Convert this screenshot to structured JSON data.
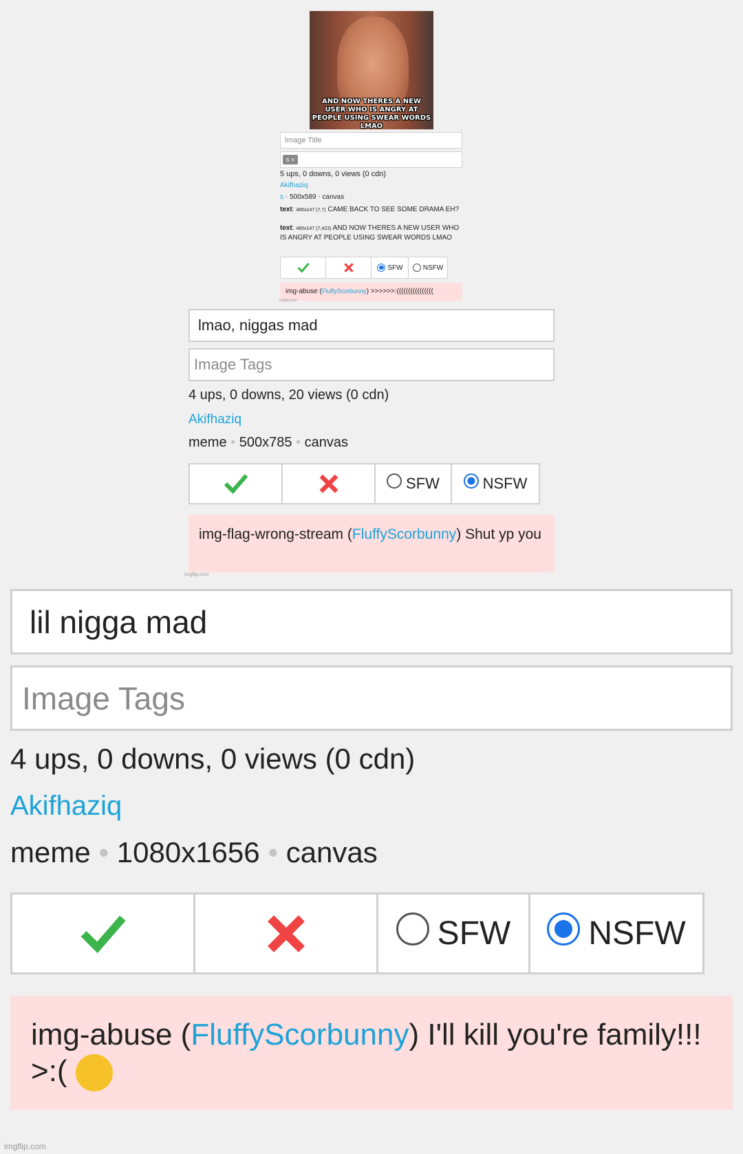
{
  "meme": {
    "caption": "AND NOW THERES A NEW USER WHO IS ANGRY AT PEOPLE USING SWEAR WORDS LMAO"
  },
  "level1": {
    "title_placeholder": "Image Title",
    "tag_chip": "s ×",
    "stats": "5 ups, 0 downs, 0 views (0 cdn)",
    "user": "Akifhaziq",
    "stream": "s",
    "size": "500x589",
    "type": "canvas",
    "text1_label": "text",
    "text1_meta": "485x147 (7,7)",
    "text1_value": "CAME BACK TO SEE SOME DRAMA EH?",
    "text2_label": "text",
    "text2_meta": "485x147 (7,423)",
    "text2_value": "AND NOW THERES A NEW USER WHO IS ANGRY AT PEOPLE USING SWEAR WORDS LMAO",
    "sfw": "SFW",
    "nsfw": "NSFW",
    "selected": "SFW",
    "flag_type": "img-abuse",
    "flag_user": "FluffyScorbunny",
    "flag_text": ">>>>>>:((((((((((((((((",
    "watermark": "imgflip.com"
  },
  "level2": {
    "title": "lmao, niggas mad",
    "tags_placeholder": "Image Tags",
    "stats": "4 ups, 0 downs, 20 views (0 cdn)",
    "user": "Akifhaziq",
    "stream": "meme",
    "size": "500x785",
    "type": "canvas",
    "sfw": "SFW",
    "nsfw": "NSFW",
    "selected": "NSFW",
    "flag_type": "img-flag-wrong-stream",
    "flag_user": "FluffyScorbunny",
    "flag_text": "Shut yp you",
    "watermark": "imgflip.com"
  },
  "level3": {
    "title": "lil nigga mad",
    "tags_placeholder": "Image Tags",
    "stats": "4 ups, 0 downs, 0 views (0 cdn)",
    "user": "Akifhaziq",
    "stream": "meme",
    "size": "1080x1656",
    "type": "canvas",
    "sfw": "SFW",
    "nsfw": "NSFW",
    "selected": "NSFW",
    "flag_type": "img-abuse",
    "flag_user": "FluffyScorbunny",
    "flag_text": "I'll kill you're family!!! >:(",
    "flag_emoji": "😠"
  },
  "footer": {
    "watermark": "imgflip.com"
  },
  "colors": {
    "link": "#1da3d8",
    "flag_bg": "#fedede",
    "check": "#3cb44b",
    "cross": "#f04444",
    "radio_on": "#1a73e8"
  }
}
